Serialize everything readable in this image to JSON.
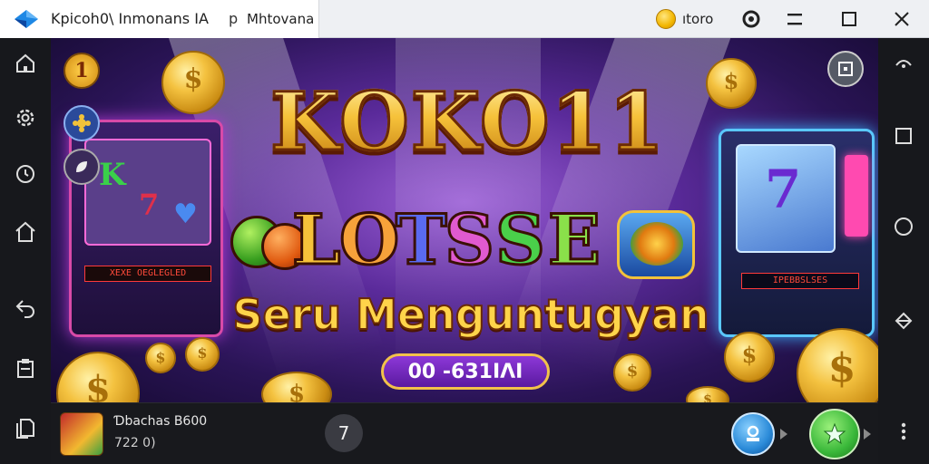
{
  "window": {
    "title": "Kpicoh0\\ Inmonans IA",
    "separator": "p",
    "subtitle": "Mhtovana",
    "coin_count": "ıtoro"
  },
  "left_sidebar": {
    "icons": [
      "home-icon",
      "settings-gear-icon",
      "history-icon",
      "house-outline-icon",
      "back-arrow-icon",
      "clipboard-icon",
      "copy-files-icon"
    ]
  },
  "right_sidebar": {
    "icons": [
      "signal-icon",
      "recent-apps-icon",
      "home-circle-icon",
      "rotate-icon",
      "more-vertical-icon"
    ]
  },
  "game": {
    "corner_badge": "1",
    "title": "KOKO11",
    "slots_letters": [
      "L",
      "O",
      "T",
      "S",
      "S",
      "E"
    ],
    "tagline": "Seru Menguntugyan",
    "button_label": "00 -631ΙΛΙ",
    "left_machine_display": "XEXE OEGLEGLED",
    "right_machine_display": "IPEBBSLSES",
    "reel_symbols_left": [
      "K",
      "7",
      "♥"
    ],
    "reel_symbols_right": [
      "7"
    ]
  },
  "bottom_bar": {
    "game_name": "Ɗbachas B600",
    "game_sub": "722 0)",
    "badge_number": "7"
  },
  "colors": {
    "accent_gold": "#f6c23a",
    "purple_bg": "#5a2a9a",
    "action_blue": "#2a8ad8",
    "action_green": "#3ab83a"
  }
}
